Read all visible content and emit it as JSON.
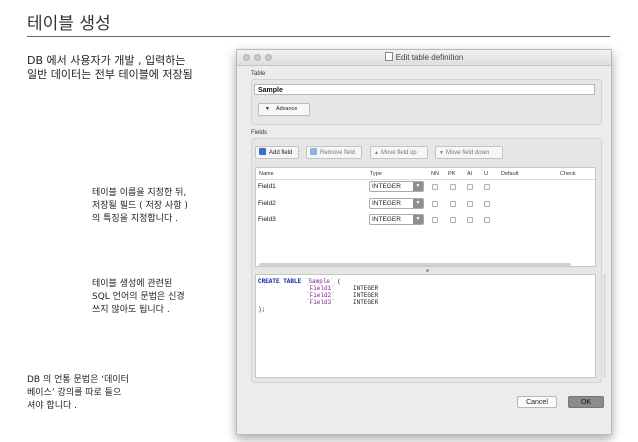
{
  "slide": {
    "title": "테이블 생성",
    "intro": "DB 에서 사용자가 개발 , 입력하는\n일반 데이터는 전부 테이블에 저장됨",
    "note1": "테이블 이름을 지정한 뒤,\n저장될 필드 ( 저장 사항 )\n의 특징을 지정합니다 .",
    "note2": "테이블 생성에 관련된\nSQL  언어의 문법은 신경\n쓰지 않아도 됩니다 .",
    "note3": "DB 의 언통 문법은 ‘데이터\n베이스’ 강의를 따로 들으\n셔야 합니다 ."
  },
  "dialog": {
    "title": "Edit table definition",
    "table_label": "Table",
    "table_name": "Sample",
    "advanced_label": "Advance",
    "fields_label": "Fields",
    "toolbar": {
      "add": "Add field",
      "remove": "Remove field",
      "up": "Move field up",
      "down": "Move field down"
    },
    "columns": [
      "Name",
      "Type",
      "NN",
      "PK",
      "AI",
      "U",
      "Default",
      "Check"
    ],
    "fields": [
      {
        "name": "Field1",
        "type": "INTEGER"
      },
      {
        "name": "Field2",
        "type": "INTEGER"
      },
      {
        "name": "Field3",
        "type": "INTEGER"
      }
    ],
    "sql": {
      "l1_kw": "CREATE TABLE",
      "l1_name": "`Sample`",
      "l1_paren": " (",
      "l2_field": "`Field1`",
      "l2_type": "INTEGER",
      "l3_field": "`Field2`",
      "l3_type": "INTEGER",
      "l4_field": "`Field3`",
      "l4_type": "INTEGER",
      "l5": ");"
    },
    "cancel_label": "Cancel",
    "ok_label": "OK"
  },
  "colors": {
    "sql_keyword": "#1a22a8",
    "sql_string": "#7a1f8e",
    "ok_button": "#8b8b8b"
  }
}
